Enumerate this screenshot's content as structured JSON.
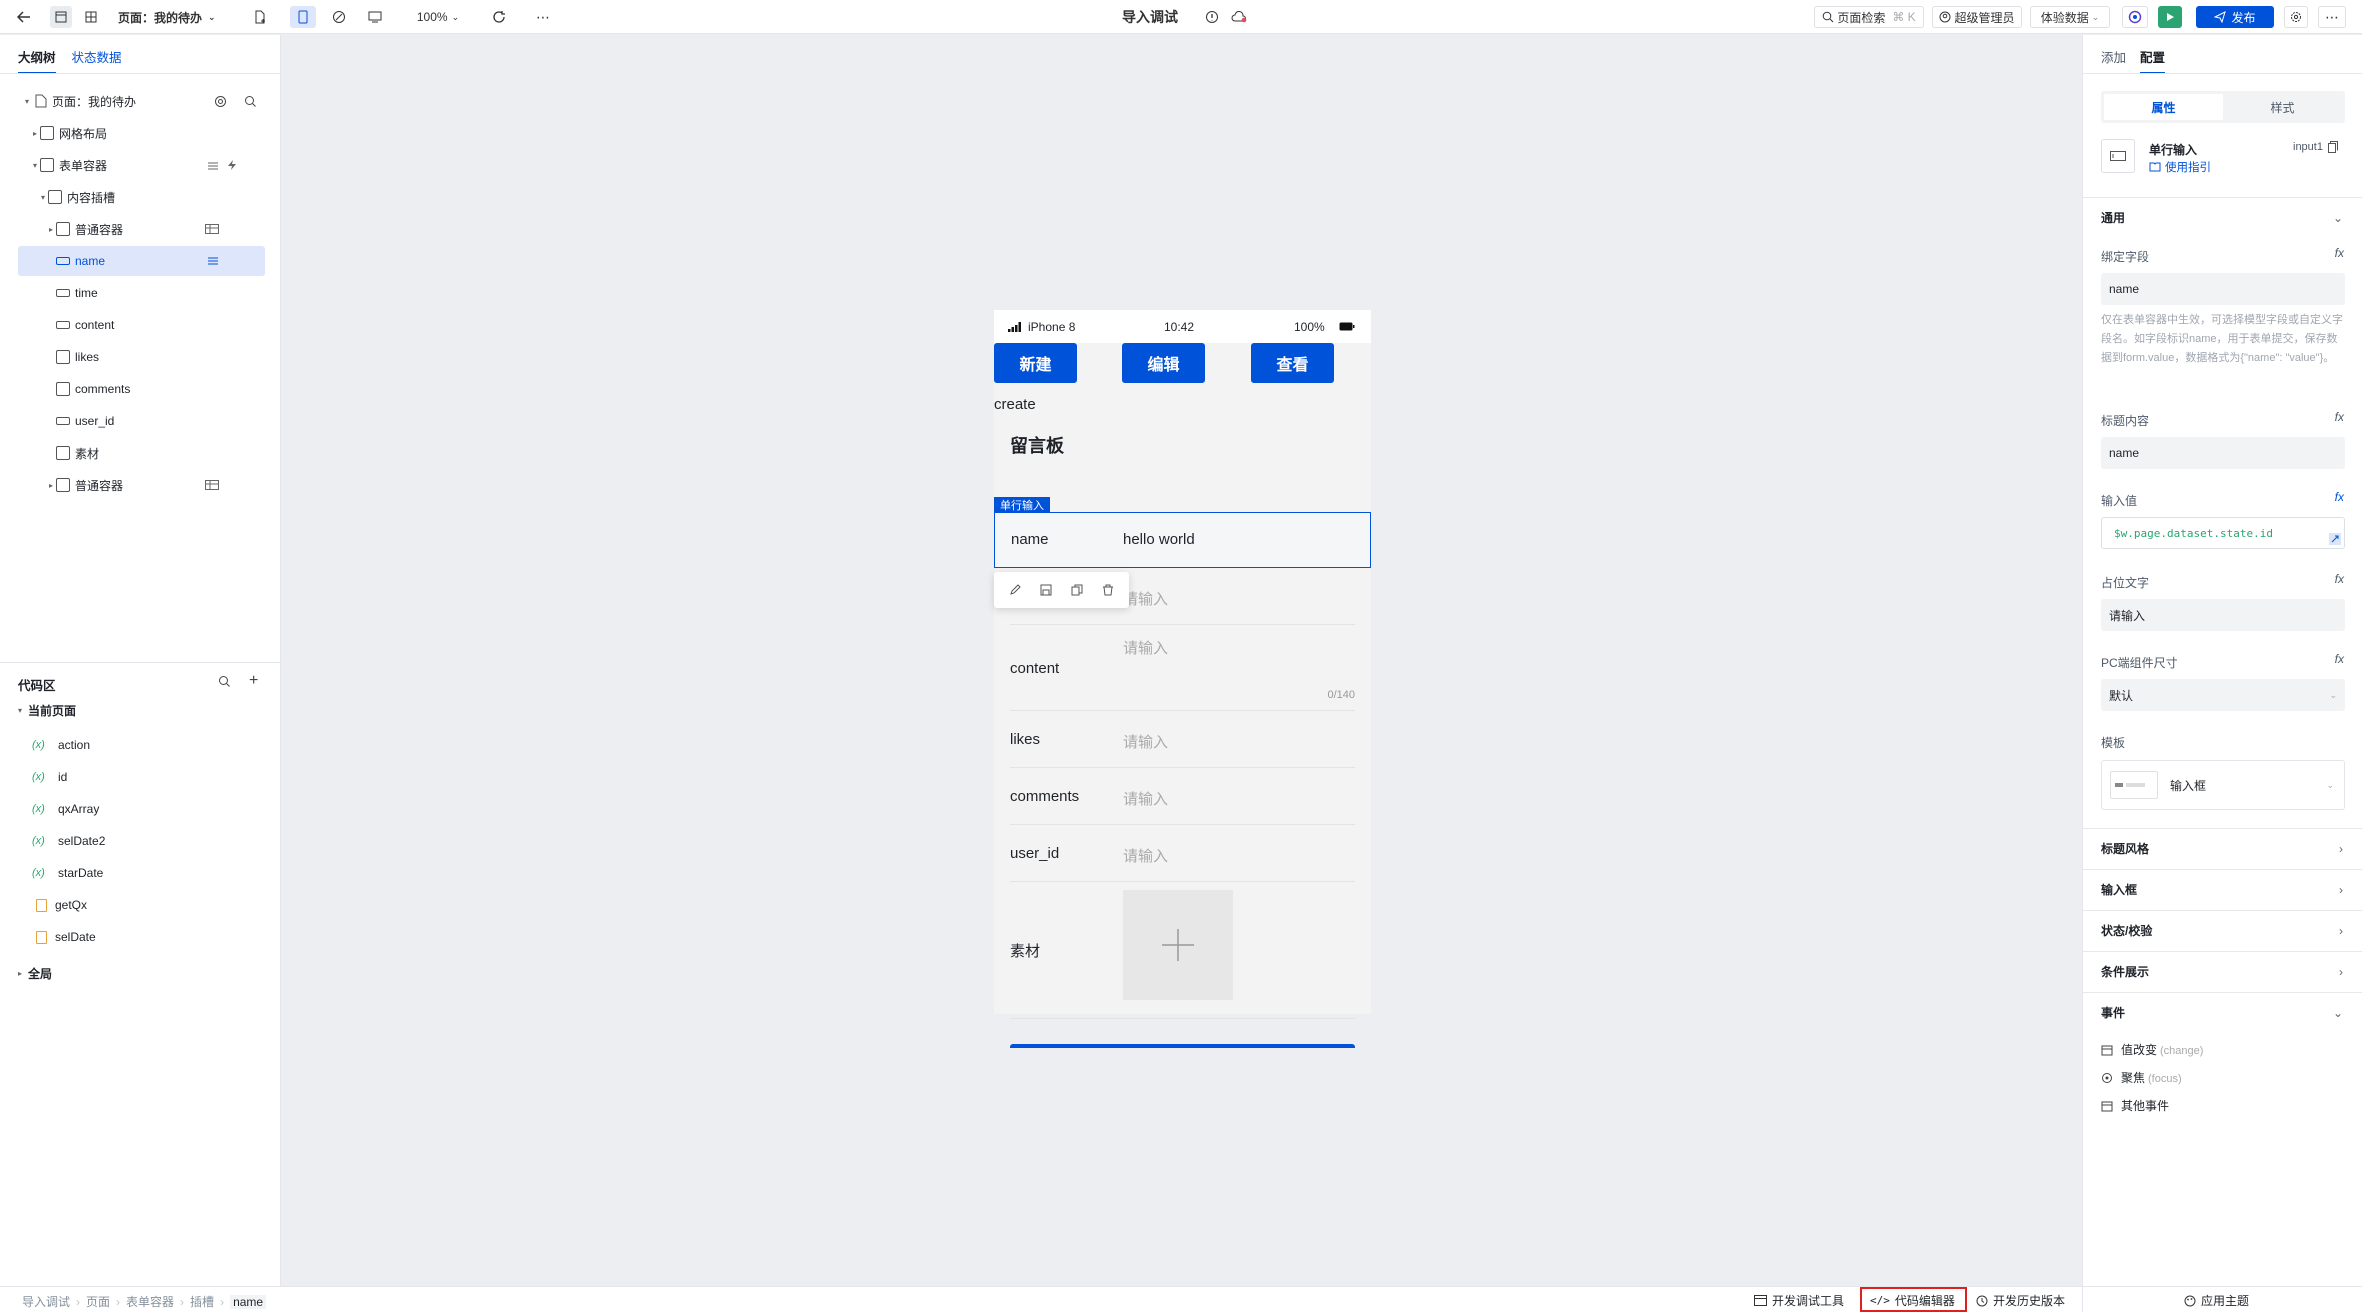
{
  "topbar": {
    "page_select": "页面：我的待办",
    "zoom": "100%",
    "title": "导入调试",
    "page_search": "页面检索",
    "page_search_shortcut": "⌘ K",
    "user_role": "超级管理员",
    "experience_data": "体验数据",
    "publish": "发布"
  },
  "left": {
    "tab_outline": "大纲树",
    "tab_state": "状态数据",
    "tree": [
      {
        "label": "页面：我的待办"
      },
      {
        "label": "网格布局"
      },
      {
        "label": "表单容器"
      },
      {
        "label": "内容插槽"
      },
      {
        "label": "普通容器"
      },
      {
        "label": "name"
      },
      {
        "label": "time"
      },
      {
        "label": "content"
      },
      {
        "label": "likes"
      },
      {
        "label": "comments"
      },
      {
        "label": "user_id"
      },
      {
        "label": "素材"
      },
      {
        "label": "普通容器"
      }
    ],
    "code_title": "代码区",
    "current_page": "当前页面",
    "code_items": [
      {
        "fx": "(x)",
        "label": "action"
      },
      {
        "fx": "(x)",
        "label": "id"
      },
      {
        "fx": "(x)",
        "label": "qxArray"
      },
      {
        "fx": "(x)",
        "label": "selDate2"
      },
      {
        "fx": "(x)",
        "label": "starDate"
      },
      {
        "label": "getQx"
      },
      {
        "label": "selDate"
      }
    ],
    "global": "全局"
  },
  "phone": {
    "device": "iPhone 8",
    "time": "10:42",
    "battery": "100%",
    "btn_new": "新建",
    "btn_edit": "编辑",
    "btn_view": "查看",
    "action_text": "create",
    "board_title": "留言板",
    "selected_tag": "单行输入",
    "name_label": "name",
    "name_value": "hello world",
    "placeholder": "请输入",
    "time_placeholder": "请输入",
    "content_label": "content",
    "content_counter": "0/140",
    "likes_label": "likes",
    "comments_label": "comments",
    "userid_label": "user_id",
    "material_label": "素材"
  },
  "right": {
    "tab_add": "添加",
    "tab_config": "配置",
    "seg_props": "属性",
    "seg_style": "样式",
    "component_name": "单行输入",
    "component_id": "input1",
    "guide": "使用指引",
    "section_general": "通用",
    "bind_field_label": "绑定字段",
    "bind_field_value": "name",
    "bind_hint": "仅在表单容器中生效，可选择模型字段或自定义字段名。如字段标识name，用于表单提交，保存数据到form.value，数据格式为{\"name\": \"value\"}。",
    "title_label": "标题内容",
    "title_value": "name",
    "input_value_label": "输入值",
    "input_value": "$w.page.dataset.state.id",
    "placeholder_label": "占位文字",
    "placeholder_value": "请输入",
    "size_label": "PC端组件尺寸",
    "size_value": "默认",
    "template_label": "模板",
    "template_value": "输入框",
    "sections": [
      "标题风格",
      "输入框",
      "状态/校验",
      "条件展示"
    ],
    "events_title": "事件",
    "events": [
      {
        "label": "值改变",
        "en": "(change)"
      },
      {
        "label": "聚焦",
        "en": "(focus)"
      },
      {
        "label": "其他事件",
        "en": ""
      }
    ],
    "fx": "fx"
  },
  "bottom": {
    "breadcrumb": [
      "导入调试",
      "页面",
      "表单容器",
      "插槽",
      "name"
    ],
    "dev_tools": "开发调试工具",
    "code_editor": "代码编辑器",
    "history": "开发历史版本",
    "theme": "应用主题"
  },
  "colors": {
    "primary": "#0052d9",
    "selected_bg": "#dde6fb",
    "highlight_box": "#e02020",
    "run_green": "#2ba471"
  }
}
